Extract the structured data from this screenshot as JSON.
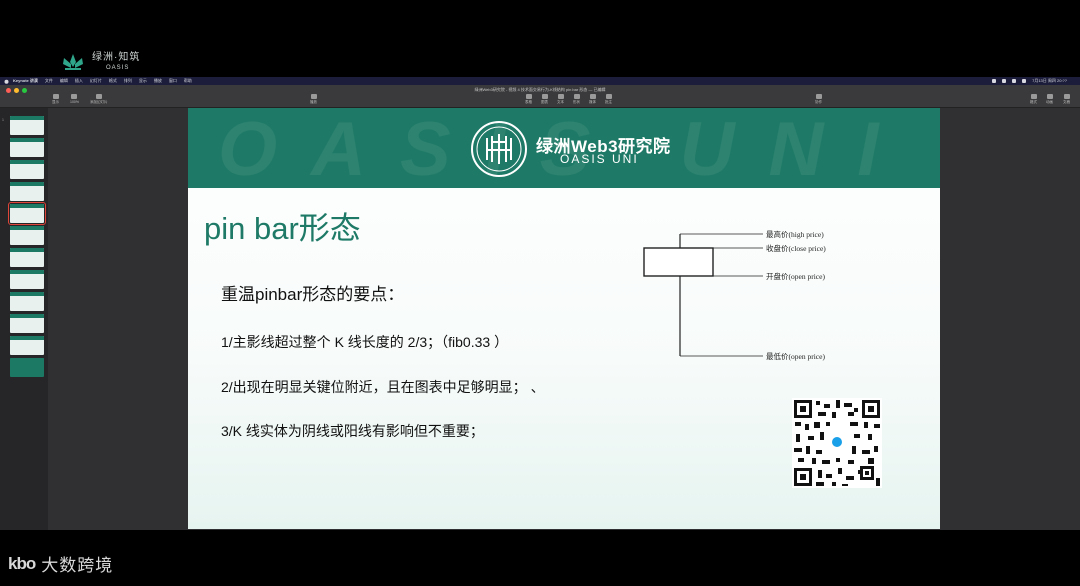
{
  "brand": {
    "cn": "绿洲·知筑",
    "en": "OASIS"
  },
  "menubar": {
    "app": "Keynote 讲演",
    "items": [
      "文件",
      "编辑",
      "插入",
      "幻灯片",
      "格式",
      "排列",
      "显示",
      "播放",
      "窗口",
      "帮助"
    ],
    "clock": "7月13日 周四 20:??"
  },
  "window": {
    "title": "绿洲Web3研究院 - 视频 4 技术面交易行为-K线结构 pin bar 形态 — 已编辑",
    "toolbar": {
      "zoom": "100%",
      "buttons": [
        "显示",
        "缩放",
        "添加幻灯片",
        "播放",
        "表格",
        "图表",
        "文本",
        "形状",
        "媒体",
        "批注",
        "协作",
        "格式",
        "动画",
        "文稿"
      ]
    }
  },
  "slides": {
    "count": 12,
    "selected_index": 5
  },
  "slide": {
    "org_cn": "绿洲Web3研究院",
    "org_en": "OASIS UNI",
    "watermark": "OASIS UNI",
    "title": "pin bar形态",
    "subtitle": "重温pinbar形态的要点：",
    "points": [
      "1/主影线超过整个 K 线长度的 2/3；（fib0.33 ）",
      "2/出现在明显关键位附近，且在图表中足够明显；    、",
      "3/K 线实体为阴线或阳线有影响但不重要；"
    ],
    "diagram": {
      "high": "最高价(high price)",
      "close": "收盘价(close price)",
      "open": "开盘价(open price)",
      "low": "最低价(open price)"
    }
  },
  "footer": {
    "logo": "kbo",
    "name": "大数跨境"
  },
  "colors": {
    "brand_green": "#1e7a66",
    "accent_red": "#e0453a"
  }
}
